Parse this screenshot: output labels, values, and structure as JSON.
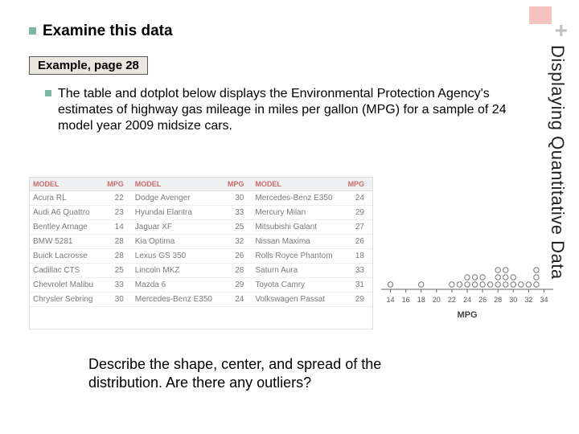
{
  "decor": {
    "plus": "+"
  },
  "vertical_title": "Displaying Quantitative Data",
  "bullets": {
    "b1_bold": "Examine",
    "b1_rest": " this data",
    "example_label": "Example, page 28",
    "b2": "The table  and dotplot below displays the Environmental Protection Agency's estimates of highway gas mileage in miles per gallon (MPG) for a sample of 24 model year 2009 midsize cars."
  },
  "table": {
    "headers": [
      "MODEL",
      "MPG",
      "MODEL",
      "MPG",
      "MODEL",
      "MPG"
    ],
    "rows": [
      [
        "Acura RL",
        "22",
        "Dodge Avenger",
        "30",
        "Mercedes-Benz E350",
        "24"
      ],
      [
        "Audi A6 Quattro",
        "23",
        "Hyundai Elantra",
        "33",
        "Mercury Milan",
        "29"
      ],
      [
        "Bentley Arnage",
        "14",
        "Jaguar XF",
        "25",
        "Mitsubishi Galant",
        "27"
      ],
      [
        "BMW 5281",
        "28",
        "Kia Optima",
        "32",
        "Nissan Maxima",
        "26"
      ],
      [
        "Buick Lacrosse",
        "28",
        "Lexus GS 350",
        "26",
        "Rolls Royce Phantom",
        "18"
      ],
      [
        "Cadillac CTS",
        "25",
        "Lincoln MKZ",
        "28",
        "Saturn Aura",
        "33"
      ],
      [
        "Chevrolet Malibu",
        "33",
        "Mazda 6",
        "29",
        "Toyota Camry",
        "31"
      ],
      [
        "Chrysler Sebring",
        "30",
        "Mercedes-Benz E350",
        "24",
        "Volkswagen Passat",
        "29"
      ]
    ]
  },
  "chart_data": {
    "type": "dotplot",
    "xlabel": "MPG",
    "xticks": [
      14,
      16,
      18,
      20,
      22,
      24,
      26,
      28,
      30,
      32,
      34
    ],
    "xlim": [
      13,
      35
    ],
    "points": {
      "14": 1,
      "18": 1,
      "22": 1,
      "23": 1,
      "24": 2,
      "25": 2,
      "26": 2,
      "27": 1,
      "28": 3,
      "29": 3,
      "30": 2,
      "31": 1,
      "32": 1,
      "33": 3
    }
  },
  "question": "Describe the shape, center, and spread of the distribution.  Are there any outliers?"
}
